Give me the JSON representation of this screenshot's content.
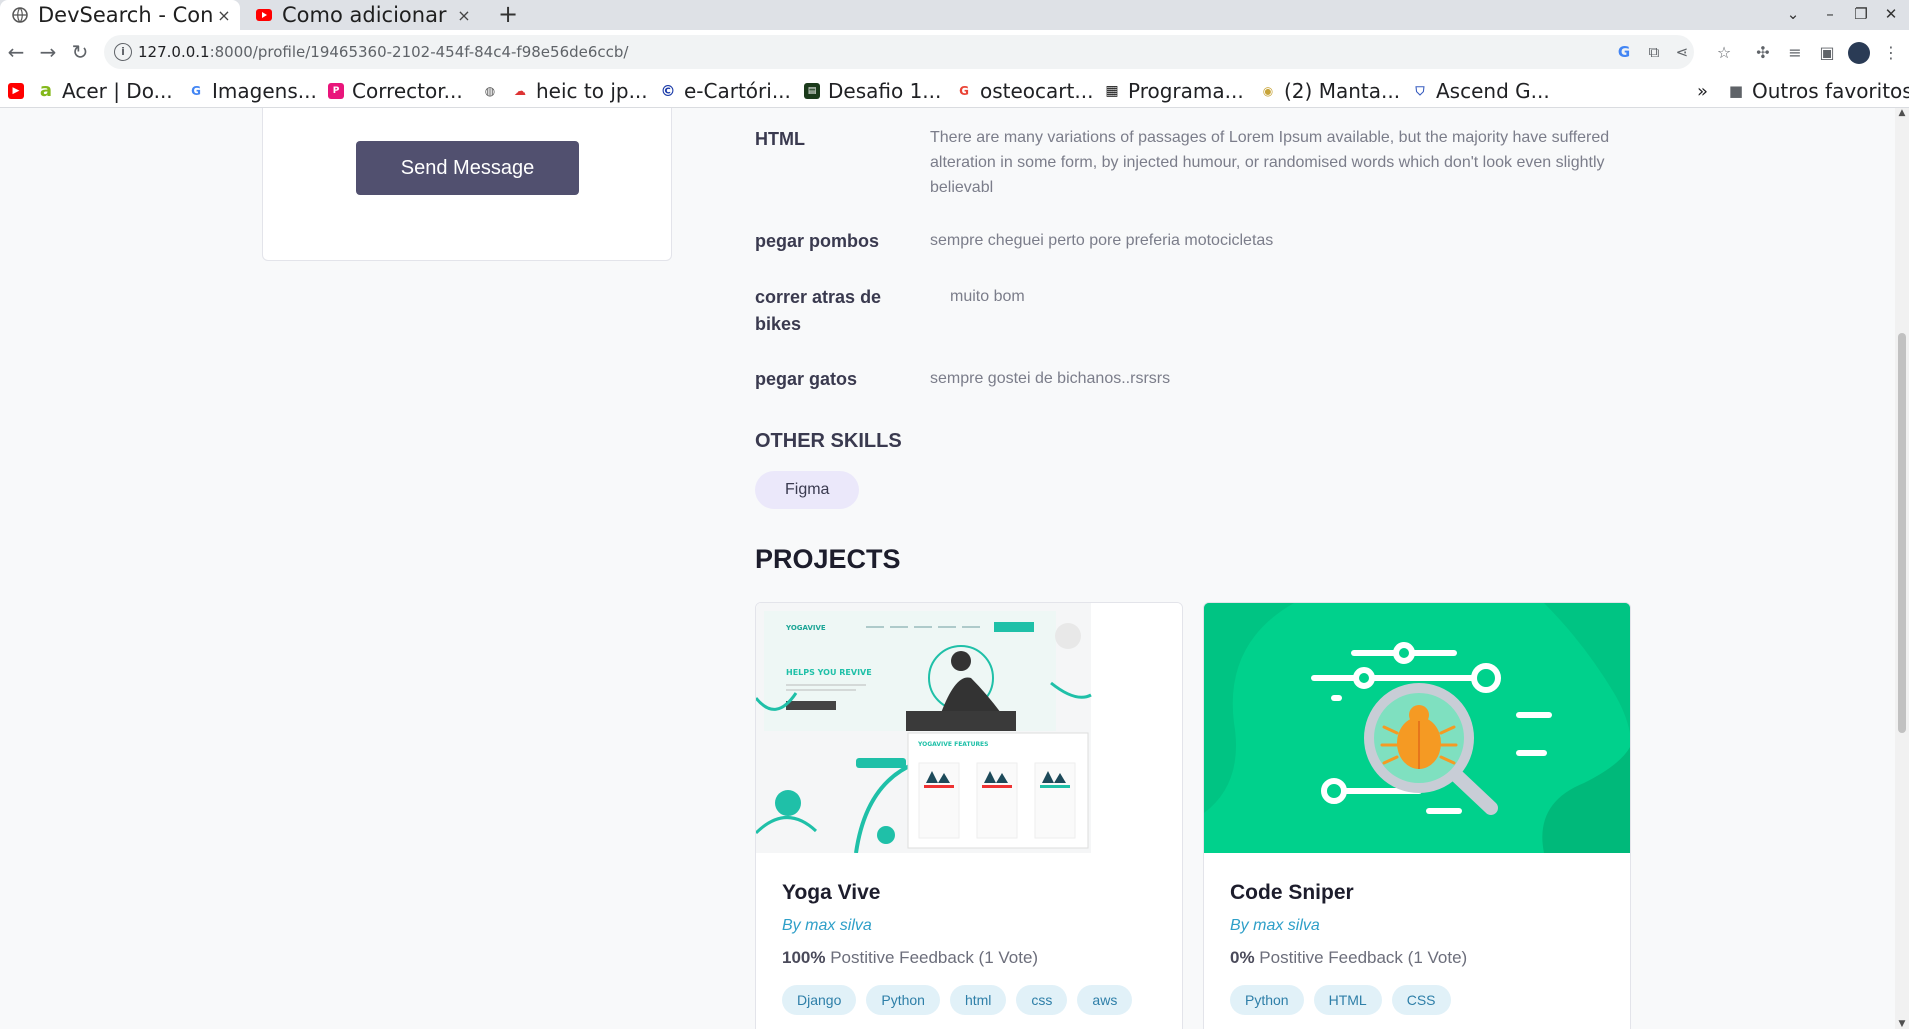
{
  "browser": {
    "tabs": [
      {
        "title": "DevSearch - Conne",
        "close": "×",
        "active": true
      },
      {
        "title": "Como adicionar im",
        "close": "×",
        "active": false
      }
    ],
    "new_tab": "+",
    "url_host": "127.0.0.1",
    "url_path": ":8000/profile/19465360-2102-454f-84c4-f98e56de6ccb/",
    "bookmarks": [
      {
        "label": "Acer | Do..."
      },
      {
        "label": "Imagens..."
      },
      {
        "label": "Corrector..."
      },
      {
        "label": "heic to jp..."
      },
      {
        "label": "e-Cartóri..."
      },
      {
        "label": "Desafio 1..."
      },
      {
        "label": "osteocart..."
      },
      {
        "label": "Programa..."
      },
      {
        "label": "(2) Manta..."
      },
      {
        "label": "Ascend G..."
      }
    ],
    "bookmarks_more": "»",
    "other_bookmarks": "Outros favoritos"
  },
  "sidebar": {
    "send_message_label": "Send Message"
  },
  "skills": [
    {
      "name": "HTML",
      "description": "There are many variations of passages of Lorem Ipsum available, but the majority have suffered alteration in some form, by injected humour, or randomised words which don't look even slightly believabl"
    },
    {
      "name": "pegar pombos",
      "description": "sempre cheguei perto pore preferia motocicletas"
    },
    {
      "name": "correr atras de bikes",
      "description": "muito bom"
    },
    {
      "name": "pegar gatos",
      "description": "sempre gostei de bichanos..rsrsrs"
    }
  ],
  "other_skills": {
    "title": "OTHER SKILLS",
    "items": [
      "Figma"
    ]
  },
  "projects": {
    "title": "PROJECTS",
    "items": [
      {
        "title": "Yoga Vive",
        "by": "By max silva",
        "percent": "100%",
        "feedback": " Postitive Feedback (1 Vote)",
        "tags": [
          "Django",
          "Python",
          "html",
          "css",
          "aws"
        ],
        "thumb_text": {
          "logo": "YOGAVIVE",
          "headline": "HELPS YOU REVIVE",
          "features": "YOGAVIVE FEATURES"
        }
      },
      {
        "title": "Code Sniper",
        "by": "By max silva",
        "percent": "0%",
        "feedback": " Postitive Feedback (1 Vote)",
        "tags": [
          "Python",
          "HTML",
          "CSS"
        ]
      }
    ]
  },
  "colors": {
    "button": "#51506f",
    "accent_teal": "#00d18c",
    "tag_bg": "#e1f1f8",
    "other_tag_bg": "#ebe8fa"
  }
}
